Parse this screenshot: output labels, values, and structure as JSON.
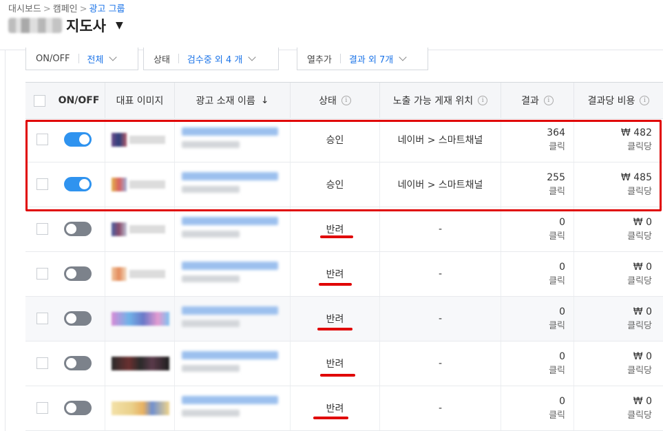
{
  "breadcrumb": {
    "items": [
      "대시보드",
      "캠페인"
    ],
    "current": "광고 그룹",
    "separator": ">"
  },
  "header": {
    "title": "지도사"
  },
  "filters": [
    {
      "label": "ON/OFF",
      "value": "전체"
    },
    {
      "label": "상태",
      "value": "검수중 외 4 개"
    },
    {
      "label": "열추가",
      "value": "결과 외 7개"
    }
  ],
  "table": {
    "headers": {
      "onoff": "ON/OFF",
      "image": "대표 이미지",
      "name": "광고 소재 이름",
      "status": "상태",
      "placement": "노출 가능 게재 위치",
      "result": "결과",
      "cost": "결과당 비용"
    },
    "info_glyph": "i",
    "sort_glyph": "↓",
    "rows": [
      {
        "toggle": "on",
        "status": "승인",
        "placement": "네이버 > 스마트채널",
        "result": "364",
        "result_unit": "클릭",
        "cost": "₩ 482",
        "cost_unit": "클릭당"
      },
      {
        "toggle": "on",
        "status": "승인",
        "placement": "네이버 > 스마트채널",
        "result": "255",
        "result_unit": "클릭",
        "cost": "₩ 485",
        "cost_unit": "클릭당"
      },
      {
        "toggle": "off",
        "status": "반려",
        "placement": "-",
        "result": "0",
        "result_unit": "클릭",
        "cost": "₩ 0",
        "cost_unit": "클릭당"
      },
      {
        "toggle": "off",
        "status": "반려",
        "placement": "-",
        "result": "0",
        "result_unit": "클릭",
        "cost": "₩ 0",
        "cost_unit": "클릭당"
      },
      {
        "toggle": "off",
        "status": "반려",
        "placement": "-",
        "result": "0",
        "result_unit": "클릭",
        "cost": "₩ 0",
        "cost_unit": "클릭당"
      },
      {
        "toggle": "off",
        "status": "반려",
        "placement": "-",
        "result": "0",
        "result_unit": "클릭",
        "cost": "₩ 0",
        "cost_unit": "클릭당"
      },
      {
        "toggle": "off",
        "status": "반려",
        "placement": "-",
        "result": "0",
        "result_unit": "클릭",
        "cost": "₩ 0",
        "cost_unit": "클릭당"
      }
    ]
  },
  "colors": {
    "accent": "#1a73e8",
    "toggle_on": "#2f93ef",
    "toggle_off": "#7c828b",
    "annotation": "#e00000"
  }
}
